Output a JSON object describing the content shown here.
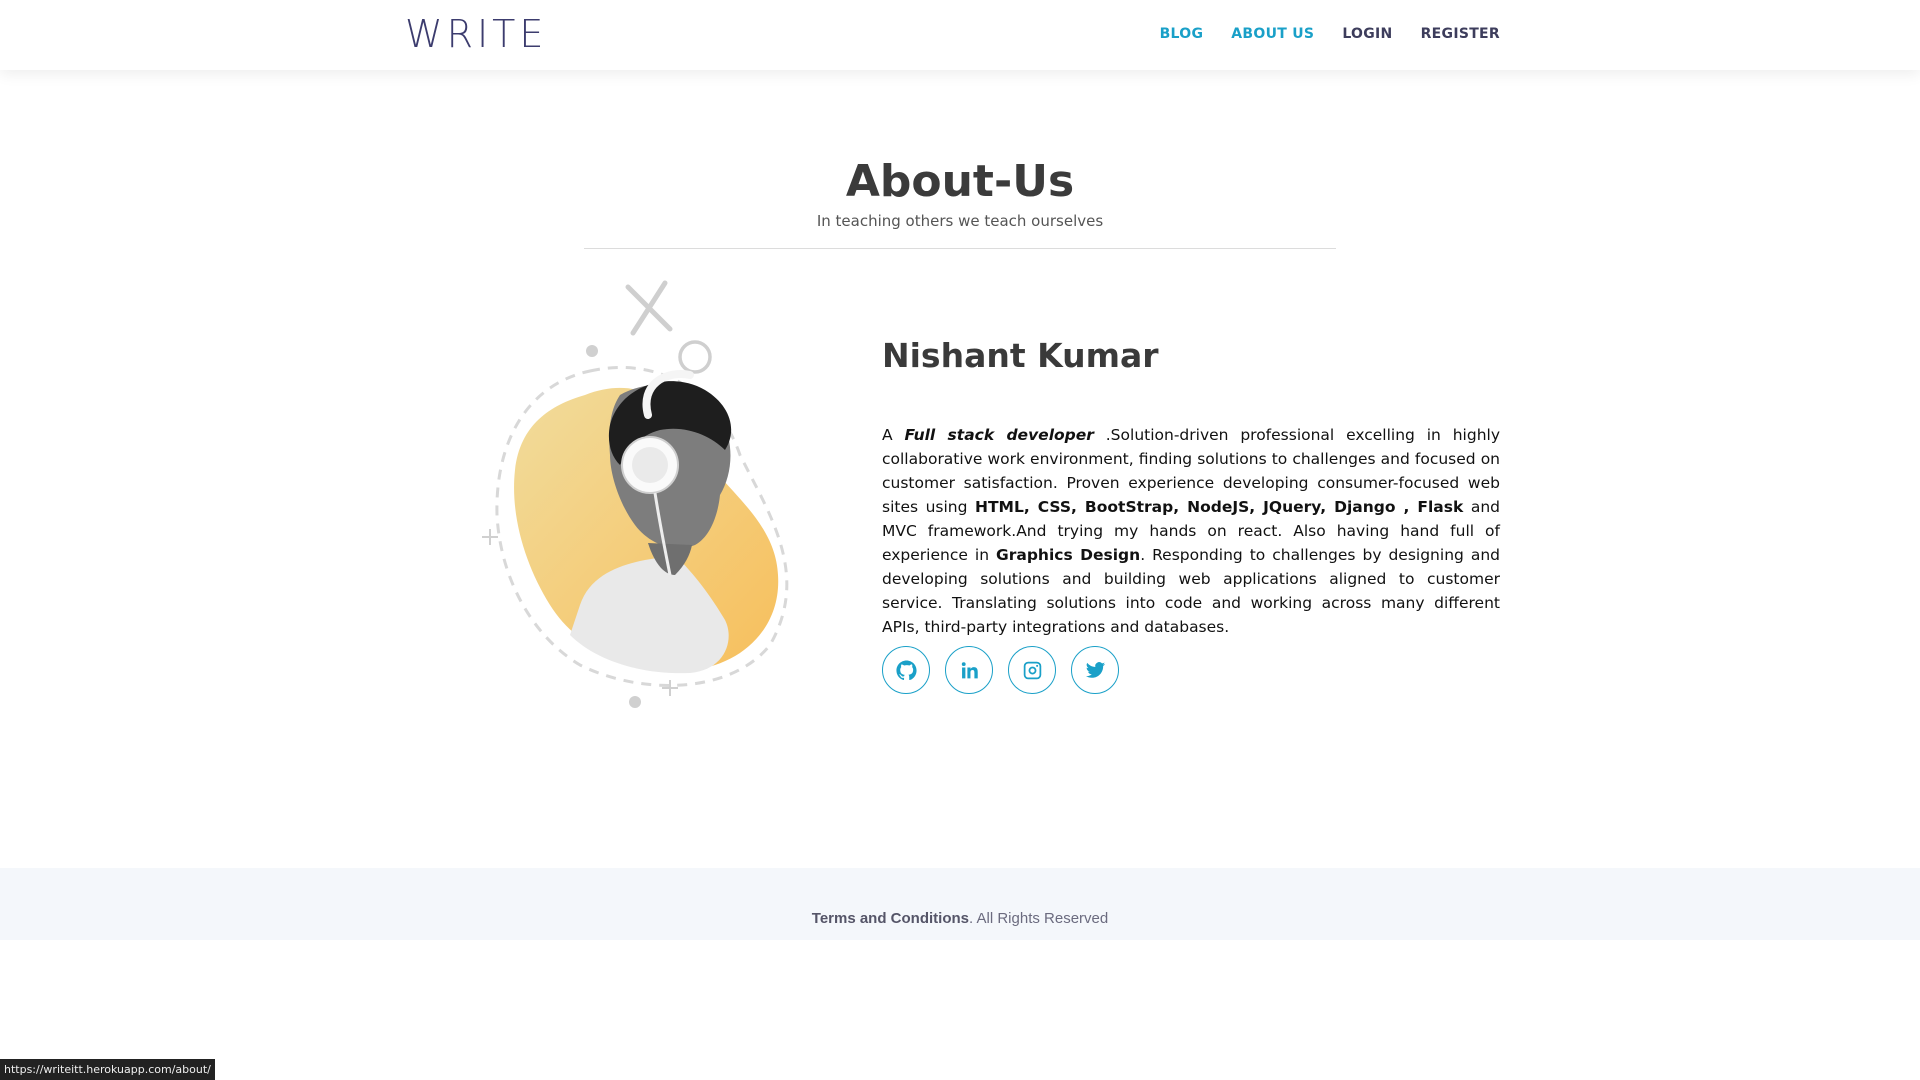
{
  "header": {
    "logo": "WRITE",
    "nav": [
      {
        "label": "BLOG"
      },
      {
        "label": "ABOUT US"
      },
      {
        "label": "LOGIN"
      },
      {
        "label": "REGISTER"
      }
    ]
  },
  "main": {
    "title": "About-Us",
    "subtitle": "In teaching others we teach ourselves",
    "profile": {
      "name": "Nishant Kumar",
      "bio": {
        "a": "A ",
        "role": "Full stack developer",
        "p1": " .Solution-driven professional excelling in highly collaborative work environment, finding solutions to challenges and focused on customer satisfaction. Proven experience developing consumer-focused web sites using ",
        "skills": "HTML, CSS, BootStrap, NodeJS, JQuery, Django , Flask",
        "p2": " and MVC framework.And trying my hands on react. Also having hand full of experience in ",
        "design": "Graphics Design",
        "p3": ". Responding to challenges by designing and developing solutions and building web applications aligned to customer service. Translating solutions into code and working across many different APIs, third-party integrations and databases."
      },
      "social": [
        {
          "icon": "github-icon"
        },
        {
          "icon": "linkedin-icon"
        },
        {
          "icon": "instagram-icon"
        },
        {
          "icon": "twitter-icon"
        }
      ]
    }
  },
  "footer": {
    "terms": "Terms and Conditions",
    "rights": ". All Rights Reserved"
  },
  "status_bar": {
    "url": "https://writeitt.herokuapp.com/about/"
  },
  "colors": {
    "accent": "#1aa0c8",
    "logo": "#3c3c6e",
    "blob": "#f7c66a",
    "footer_bg": "#f4f7fb"
  }
}
